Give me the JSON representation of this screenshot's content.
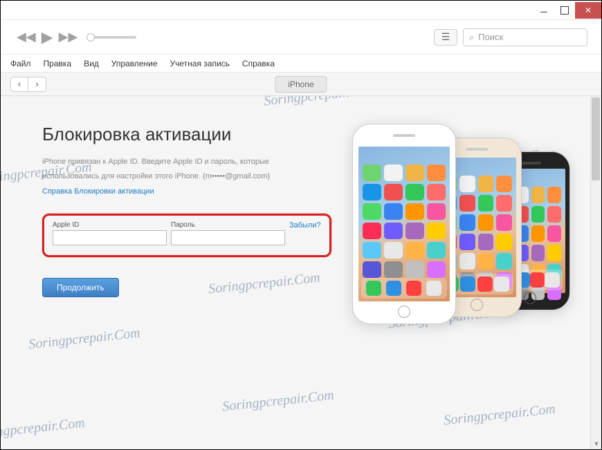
{
  "window": {
    "minimize": "−",
    "maximize": "□",
    "close": "✕"
  },
  "toolbar": {
    "search_placeholder": "Поиск",
    "apple_glyph": ""
  },
  "menubar": {
    "file": "Файл",
    "edit": "Правка",
    "view": "Вид",
    "controls": "Управление",
    "account": "Учетная запись",
    "help": "Справка"
  },
  "navbar": {
    "device_label": "iPhone"
  },
  "activation": {
    "heading": "Блокировка активации",
    "desc_line1": "iPhone привязан к Apple ID. Введите Apple ID и пароль, которые",
    "desc_line2": "использовались для настройки этого iPhone. (m•••••@gmail.com)",
    "help_link": "Справка Блокировки активации",
    "apple_id_label": "Apple ID",
    "password_label": "Пароль",
    "forgot_link": "Забыли?",
    "continue_button": "Продолжить"
  },
  "watermark": "Soringpcrepair.Com",
  "app_colors": [
    "#6fd36f",
    "#f2f2f2",
    "#f0b445",
    "#ff8f3f",
    "#1895e6",
    "#f05050",
    "#34c759",
    "#ff6c6c",
    "#4cd964",
    "#3a83f0",
    "#ff9500",
    "#f856a0",
    "#ff2d55",
    "#6f5cff",
    "#a569bd",
    "#ffcc00",
    "#5ac8fa",
    "#e8e8e8",
    "#ffb347",
    "#48d1cc",
    "#5856d6",
    "#8e8e93",
    "#c0c0c0",
    "#d96fff"
  ],
  "dock_colors": [
    "#34c759",
    "#2f8fe0",
    "#ff4040",
    "#e8e8e8"
  ]
}
